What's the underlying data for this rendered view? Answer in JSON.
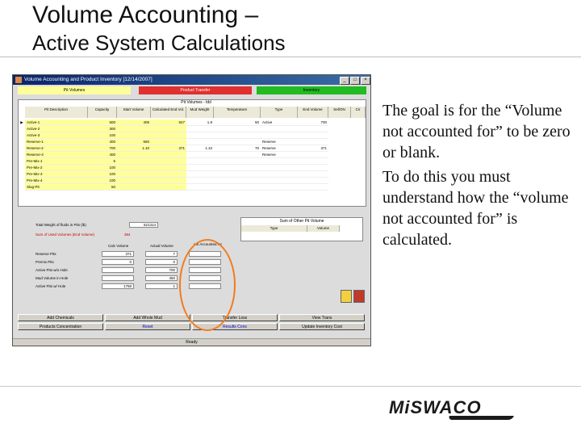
{
  "slide": {
    "title_line1": "Volume Accounting –",
    "title_line2": "Active System Calculations",
    "body_paragraphs": [
      "The goal is for the “Volume not accounted for” to be zero or blank.",
      "To do this you must understand how the “volume not accounted for” is calculated."
    ],
    "logo_text": "MiSWACO"
  },
  "window": {
    "title": "Volume Accounting and Product Inventory [12/14/2007]",
    "tabs": [
      {
        "label": "Pit Volumes",
        "color": "#ffff99"
      },
      {
        "label": "Product Transfer",
        "color": "#e03030"
      },
      {
        "label": "Inventory",
        "color": "#22bb22"
      }
    ],
    "grid_caption": "Pit Volumes - bbl",
    "columns": [
      "Pit Description",
      "Capacity",
      "Start Volume",
      "Calculated End Vol.",
      "Mud Weight",
      "Temperature",
      "Type",
      "End Volume",
      "Sel/ON",
      "Cir"
    ],
    "rows": [
      {
        "name": "Active-1",
        "capacity": "500",
        "start": "405",
        "calc_end": "847",
        "weight": "1.8",
        "temp": "50",
        "type": "Active",
        "end": "700"
      },
      {
        "name": "Active-2",
        "capacity": "300",
        "start": "",
        "calc_end": "",
        "weight": "",
        "temp": "",
        "type": "",
        "end": ""
      },
      {
        "name": "Active-3",
        "capacity": "100",
        "start": "",
        "calc_end": "",
        "weight": "",
        "temp": "",
        "type": "",
        "end": ""
      },
      {
        "name": "Reserve-1",
        "capacity": "400",
        "start": "550",
        "calc_end": "",
        "weight": "",
        "temp": "",
        "type": "Reserve",
        "end": ""
      },
      {
        "name": "Reserve-2",
        "capacity": "700",
        "start": "1.10",
        "calc_end": "371",
        "weight": "1.10",
        "temp": "70",
        "type": "Reserve",
        "end": "371"
      },
      {
        "name": "Reserve-3",
        "capacity": "400",
        "start": "",
        "calc_end": "",
        "weight": "",
        "temp": "",
        "type": "Reserve",
        "end": ""
      },
      {
        "name": "Pre-Mix-1",
        "capacity": "5",
        "start": "",
        "calc_end": "",
        "weight": "",
        "temp": "",
        "type": "",
        "end": ""
      },
      {
        "name": "Pre-Mix-2",
        "capacity": "100",
        "start": "",
        "calc_end": "",
        "weight": "",
        "temp": "",
        "type": "",
        "end": ""
      },
      {
        "name": "Pre-Mix-3",
        "capacity": "100",
        "start": "",
        "calc_end": "",
        "weight": "",
        "temp": "",
        "type": "",
        "end": ""
      },
      {
        "name": "Pre-Mix-4",
        "capacity": "100",
        "start": "",
        "calc_end": "",
        "weight": "",
        "temp": "",
        "type": "",
        "end": ""
      },
      {
        "name": "Slug-Pit",
        "capacity": "50",
        "start": "",
        "calc_end": "",
        "weight": "",
        "temp": "",
        "type": "",
        "end": ""
      }
    ],
    "total_weight_label": "Total Weight of fluids in Pits (lb)",
    "total_weight_value": "521314",
    "sum_header": "Sum of Other Pit Volume",
    "sum_cols": [
      "Type",
      "Volume"
    ],
    "section_label": "Sum of Used Volumes (End Volume)",
    "section_value": "384",
    "field_cols": [
      "Calc Volume",
      "Actual Volume",
      "Vol Accounted for"
    ],
    "field_rows": [
      {
        "label": "Reserve Pits",
        "calc": "371",
        "actual": "7",
        "acct": ""
      },
      {
        "label": "Premix Pits",
        "calc": "0",
        "actual": "0",
        "acct": ""
      },
      {
        "label": "Active Pits w/o Hole",
        "calc": "",
        "actual": "700",
        "acct": ""
      },
      {
        "label": "Mud Volume in Hole",
        "calc": "",
        "actual": "450",
        "acct": ""
      },
      {
        "label": "Active Pits w/ Hole",
        "calc": "1758",
        "actual": "1",
        "acct": ""
      }
    ],
    "buttons_row1": [
      "Add Chemicals",
      "Add Whole Mud",
      "Transfer Loss",
      "View Trans"
    ],
    "buttons_row2": [
      "Products Concentration",
      "Reset",
      "Results Cons",
      "Update Inventory Cost"
    ],
    "status": "Ready",
    "accent_circle_color": "#f07c1e"
  }
}
